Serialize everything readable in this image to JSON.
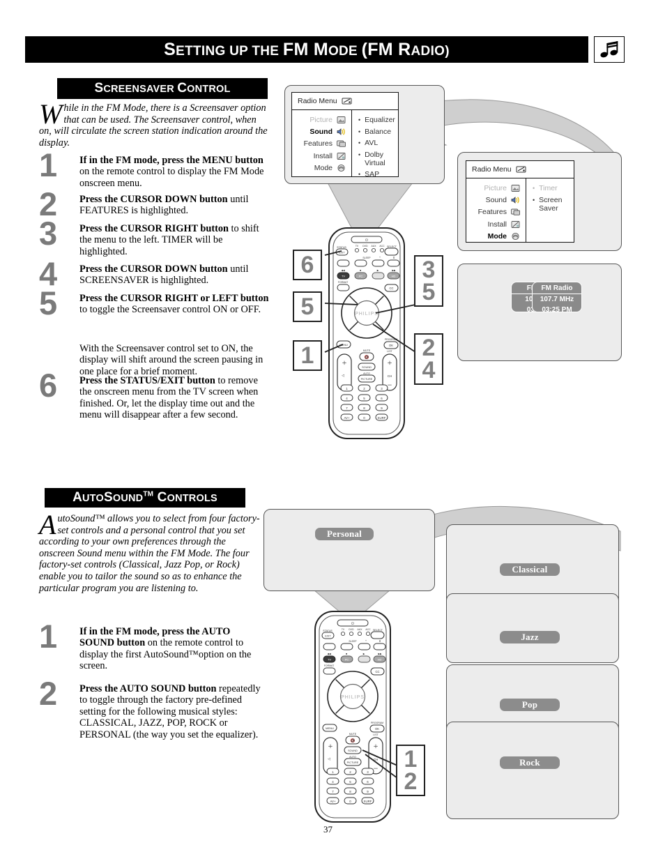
{
  "page": {
    "title": "Setting up the FM Mode (FM Radio)",
    "title_parts": {
      "p1": "S",
      "p2": "ETTING UP THE ",
      "p3": "FM M",
      "p4": "ODE ",
      "p5": "(FM R",
      "p6": "ADIO)"
    },
    "number": "37",
    "header_icon": "music-note-icon"
  },
  "screensaver": {
    "heading": "Screensaver Control",
    "heading_parts": {
      "a": "S",
      "b": "CREENSAVER ",
      "c": "C",
      "d": "ONTROL"
    },
    "intro_cap": "W",
    "intro": "hile in the FM Mode, there is a Screensaver option that can be used. The Screensaver control, when on, will circulate the screen station indication around the display.",
    "steps": [
      {
        "num": "1",
        "bold": "If in the FM mode, press the MENU button",
        "rest": " on the remote control to display the FM Mode onscreen menu."
      },
      {
        "num": "2",
        "bold": "Press the CURSOR DOWN button",
        "rest": " until FEATURES is highlighted."
      },
      {
        "num": "3",
        "bold": "Press the CURSOR RIGHT button",
        "rest": " to shift the menu to the left. TIMER will be highlighted."
      },
      {
        "num": "4",
        "bold": "Press the CURSOR DOWN button",
        "rest": " until SCREENSAVER is highlighted."
      },
      {
        "num": "5",
        "bold": "Press the CURSOR RIGHT or LEFT button",
        "rest": " to toggle the Screensaver control ON or OFF."
      },
      {
        "num": "6",
        "bold": "Press the STATUS/EXIT button",
        "rest": " to remove the onscreen menu from the TV screen when finished. Or, let the display time out and the menu will disappear after a few second."
      }
    ],
    "note": "With the Screensaver control set to ON, the display will shift around the screen pausing in one place for a brief moment."
  },
  "autosound": {
    "heading": "AutoSound™ Controls",
    "heading_parts": {
      "a": "A",
      "b": "UTO",
      "c": "S",
      "d": "OUND",
      "e": "TM",
      "f": " C",
      "g": "ONTROLS"
    },
    "intro_cap": "A",
    "intro": "utoSound™ allows you to select from four factory-set controls and a personal control that you set according to your own preferences through the onscreen Sound menu within the FM Mode. The four factory-set controls (Classical, Jazz Pop, or Rock) enable you to tailor the sound so as to enhance the particular program you are listening to.",
    "steps": [
      {
        "num": "1",
        "bold": "If in the FM mode, press the AUTO SOUND button",
        "rest": " on the remote control to display the first AutoSound™option on the screen."
      },
      {
        "num": "2",
        "bold": "Press the AUTO SOUND button",
        "rest": " repeatedly to toggle through the factory pre-defined setting for the following musical styles: CLASSICAL, JAZZ, POP, ROCK or PERSONAL (the way you set the equalizer)."
      }
    ],
    "modes": [
      {
        "label": "Personal"
      },
      {
        "label": "Classical"
      },
      {
        "label": "Jazz"
      },
      {
        "label": "Pop"
      },
      {
        "label": "Rock"
      }
    ]
  },
  "osd_sound": {
    "title": "Radio Menu",
    "title_icon": "radio-menu-icon",
    "left_items": [
      {
        "label": "Picture",
        "state": "dim",
        "icon": "picture-icon"
      },
      {
        "label": "Sound",
        "state": "selected",
        "icon": "sound-icon"
      },
      {
        "label": "Features",
        "state": "normal",
        "icon": "features-icon"
      },
      {
        "label": "Install",
        "state": "normal",
        "icon": "install-icon"
      },
      {
        "label": "Mode",
        "state": "normal",
        "icon": "mode-icon"
      }
    ],
    "right_items": [
      {
        "label": "Equalizer",
        "state": "normal"
      },
      {
        "label": "Balance",
        "state": "normal"
      },
      {
        "label": "AVL",
        "state": "normal"
      },
      {
        "label": "Dolby Virtual",
        "state": "normal"
      },
      {
        "label": "SAP",
        "state": "normal"
      }
    ]
  },
  "osd_mode": {
    "title": "Radio Menu",
    "title_icon": "radio-menu-icon",
    "left_items": [
      {
        "label": "Picture",
        "state": "dim",
        "icon": "picture-icon"
      },
      {
        "label": "Sound",
        "state": "normal",
        "icon": "sound-icon"
      },
      {
        "label": "Features",
        "state": "normal",
        "icon": "features-icon"
      },
      {
        "label": "Install",
        "state": "normal",
        "icon": "install-icon"
      },
      {
        "label": "Mode",
        "state": "selected",
        "icon": "mode-icon"
      }
    ],
    "right_items": [
      {
        "label": "Timer",
        "state": "dim"
      },
      {
        "label": "Screen Saver",
        "state": "normal"
      }
    ]
  },
  "fm_display": {
    "back_tag": {
      "head": "FM",
      "line1": "107.",
      "line2": "03:"
    },
    "front_tag": {
      "head": "FM Radio",
      "line1": "107.7 MHz",
      "line2": "03:25 PM"
    }
  },
  "callouts": {
    "top": [
      {
        "id": "c6",
        "lines": [
          "6"
        ]
      },
      {
        "id": "c5",
        "lines": [
          "5"
        ]
      },
      {
        "id": "c35",
        "lines": [
          "3",
          "5"
        ]
      },
      {
        "id": "c1",
        "lines": [
          "1"
        ]
      },
      {
        "id": "c24",
        "lines": [
          "2",
          "4"
        ]
      }
    ],
    "bottom": [
      {
        "id": "c12",
        "lines": [
          "1",
          "2"
        ]
      }
    ]
  },
  "remote": {
    "brand": "PHILIPS",
    "labels": {
      "status_exit": "STATUS",
      "exit": "EXIT",
      "select": "SELECT",
      "menu": "MENU",
      "mute": "MUTE",
      "ok": "OK",
      "program": "PROGRAM",
      "list": "LIST",
      "format": "FORMAT",
      "sleep": "SLEEP",
      "cc": "CC",
      "sound": "SOUND",
      "auto": "AUTO",
      "picture": "PICTURE",
      "ch": "CH",
      "tv": "TV",
      "dvd": "DVD",
      "aux": "AUX",
      "acc": "ACC",
      "hd": "HD",
      "pc": "PC",
      "av": "AV+",
      "surf": "SURF"
    },
    "keypad": [
      "1",
      "2",
      "3",
      "4",
      "5",
      "6",
      "7",
      "8",
      "9",
      "AV+",
      "0",
      "SURF"
    ]
  }
}
